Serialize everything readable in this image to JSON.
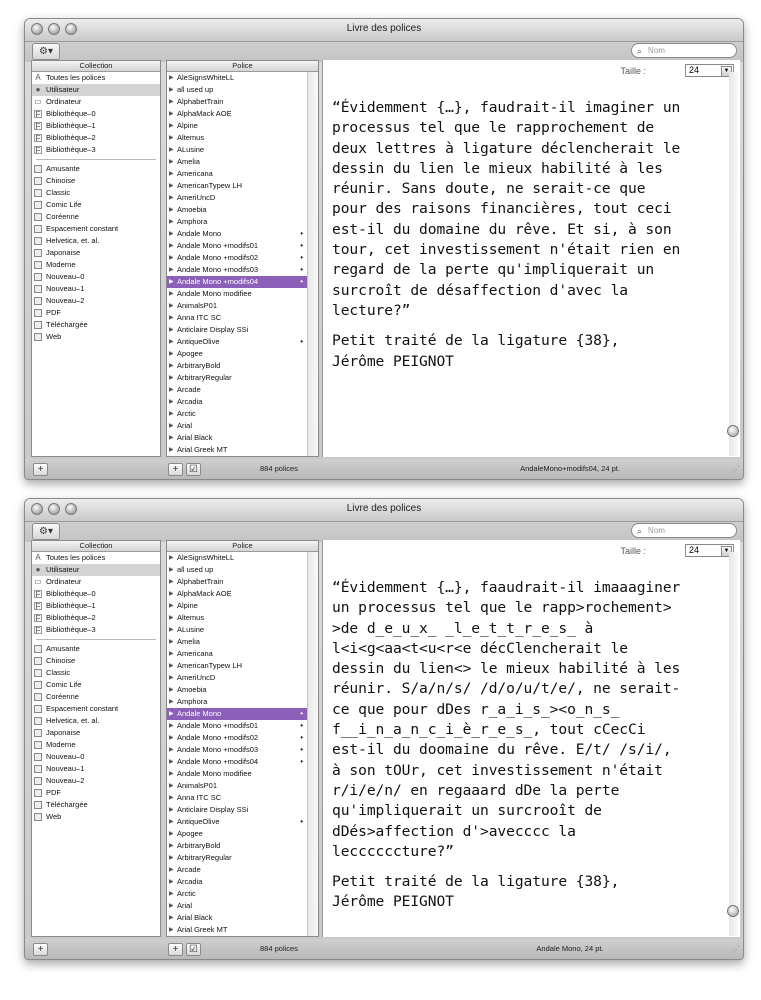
{
  "windows": [
    {
      "title": "Livre des polices",
      "search_placeholder": "Nom",
      "collection_header": "Collection",
      "font_header": "Police",
      "collections": [
        {
          "label": "Toutes les polices",
          "icon": "A"
        },
        {
          "label": "Utilisateur",
          "icon": "person",
          "selected": true
        },
        {
          "label": "Ordinateur",
          "icon": "monitor"
        },
        {
          "label": "Bibliothèque–0",
          "icon": "library"
        },
        {
          "label": "Bibliothèque–1",
          "icon": "library"
        },
        {
          "label": "Bibliothèque–2",
          "icon": "library"
        },
        {
          "label": "Bibliothèque–3",
          "icon": "library"
        }
      ],
      "sets": [
        "Amusante",
        "Chinoise",
        "Classic",
        "Comic Life",
        "Coréenne",
        "Espacement constant",
        "Helvetica, et. al.",
        "Japonaise",
        "Moderne",
        "Nouveau–0",
        "Nouveau–1",
        "Nouveau–2",
        "PDF",
        "Téléchargée",
        "Web"
      ],
      "fonts": [
        {
          "name": "AleSignsWhiteLL"
        },
        {
          "name": "all used up"
        },
        {
          "name": "AlphabetTrain"
        },
        {
          "name": "AlphaMack AOE"
        },
        {
          "name": "Alpine"
        },
        {
          "name": "Altemus"
        },
        {
          "name": "ALusine"
        },
        {
          "name": "Amelia"
        },
        {
          "name": "Americana"
        },
        {
          "name": "AmericanTypew LH"
        },
        {
          "name": "AmeriUncD"
        },
        {
          "name": "Amoebia"
        },
        {
          "name": "Amphora"
        },
        {
          "name": "Andale Mono",
          "dot": true
        },
        {
          "name": "Andale Mono +modifs01",
          "dot": true
        },
        {
          "name": "Andale Mono +modifs02",
          "dot": true
        },
        {
          "name": "Andale Mono +modifs03",
          "dot": true
        },
        {
          "name": "Andale Mono +modifs04",
          "dot": true,
          "selected": true
        },
        {
          "name": "Andale Mono modifiee"
        },
        {
          "name": "AnimalsP01"
        },
        {
          "name": "Anna ITC SC"
        },
        {
          "name": "Anticlaire Display SSi"
        },
        {
          "name": "AntiqueOlive",
          "dot": true
        },
        {
          "name": "Apogee"
        },
        {
          "name": "ArbitraryBold"
        },
        {
          "name": "ArbitraryRegular"
        },
        {
          "name": "Arcade"
        },
        {
          "name": "Arcadia"
        },
        {
          "name": "Arctic"
        },
        {
          "name": "Arial"
        },
        {
          "name": "Arial Black"
        },
        {
          "name": "Arial Greek MT"
        }
      ],
      "size_label": "Taille :",
      "size_value": "24",
      "font_count": "884 polices",
      "status": "AndaleMono+modifs04, 24 pt.",
      "preview_lines": [
        "“Évidemment {…}, faudrait-il imaginer un",
        "processus tel que le rapprochement de",
        "deux lettres à ligature déclencherait le",
        "dessin du lien le mieux habilité à les",
        "réunir. Sans doute, ne serait-ce que",
        "pour des raisons financières, tout ceci",
        "est-il du domaine du rêve. Et si, à son",
        "tour, cet investissement n'était rien en",
        "regard de la perte qu'impliquerait un",
        "surcroît de désaffection d'avec la",
        "lecture?”"
      ],
      "preview_credit": [
        "Petit traité de la ligature {38},",
        "Jérôme PEIGNOT"
      ]
    },
    {
      "title": "Livre des polices",
      "search_placeholder": "Nom",
      "collection_header": "Collection",
      "font_header": "Police",
      "collections": [
        {
          "label": "Toutes les polices",
          "icon": "A"
        },
        {
          "label": "Utilisateur",
          "icon": "person",
          "selected": true
        },
        {
          "label": "Ordinateur",
          "icon": "monitor"
        },
        {
          "label": "Bibliothèque–0",
          "icon": "library"
        },
        {
          "label": "Bibliothèque–1",
          "icon": "library"
        },
        {
          "label": "Bibliothèque–2",
          "icon": "library"
        },
        {
          "label": "Bibliothèque–3",
          "icon": "library"
        }
      ],
      "sets": [
        "Amusante",
        "Chinoise",
        "Classic",
        "Comic Life",
        "Coréenne",
        "Espacement constant",
        "Helvetica, et. al.",
        "Japonaise",
        "Moderne",
        "Nouveau–0",
        "Nouveau–1",
        "Nouveau–2",
        "PDF",
        "Téléchargée",
        "Web"
      ],
      "fonts": [
        {
          "name": "AleSignsWhiteLL"
        },
        {
          "name": "all used up"
        },
        {
          "name": "AlphabetTrain"
        },
        {
          "name": "AlphaMack AOE"
        },
        {
          "name": "Alpine"
        },
        {
          "name": "Altemus"
        },
        {
          "name": "ALusine"
        },
        {
          "name": "Amelia"
        },
        {
          "name": "Americana"
        },
        {
          "name": "AmericanTypew LH"
        },
        {
          "name": "AmeriUncD"
        },
        {
          "name": "Amoebia"
        },
        {
          "name": "Amphora"
        },
        {
          "name": "Andale Mono",
          "dot": true,
          "selected": true
        },
        {
          "name": "Andale Mono +modifs01",
          "dot": true
        },
        {
          "name": "Andale Mono +modifs02",
          "dot": true
        },
        {
          "name": "Andale Mono +modifs03",
          "dot": true
        },
        {
          "name": "Andale Mono +modifs04",
          "dot": true
        },
        {
          "name": "Andale Mono modifiee"
        },
        {
          "name": "AnimalsP01"
        },
        {
          "name": "Anna ITC SC"
        },
        {
          "name": "Anticlaire Display SSi"
        },
        {
          "name": "AntiqueOlive",
          "dot": true
        },
        {
          "name": "Apogee"
        },
        {
          "name": "ArbitraryBold"
        },
        {
          "name": "ArbitraryRegular"
        },
        {
          "name": "Arcade"
        },
        {
          "name": "Arcadia"
        },
        {
          "name": "Arctic"
        },
        {
          "name": "Arial"
        },
        {
          "name": "Arial Black"
        },
        {
          "name": "Arial Greek MT"
        }
      ],
      "size_label": "Taille :",
      "size_value": "24",
      "font_count": "884 polices",
      "status": "Andale Mono, 24 pt.",
      "preview_lines": [
        "“Évidemment {…}, faaudrait-il imaaaginer",
        "un processus tel que le rapp>rochement>",
        ">de d_e_u_x_ _l_e_t_t_r_e_s_ à",
        "l<i<g<aa<t<u<r<e décClencherait le",
        "dessin du lien<> le mieux habilité à les",
        "réunir. S/a/n/s/ /d/o/u/t/e/, ne serait-",
        "ce que pour dDes r_a_i_s_><o_n_s_",
        "f__i_n_a_n_c_i_è_r_e_s_, tout cCecCi",
        "est-il du doomaine du rêve. E/t/ /s/i/,",
        "à son tOUr, cet investissement n'était",
        "r/i/e/n/ en regaaard dDe la perte",
        "qu'impliquerait un surcrooît de",
        "dDés>affection d'>avecccc la",
        "leccccccture?”"
      ],
      "preview_credit": [
        "Petit traité de la ligature {38},",
        "Jérôme PEIGNOT"
      ]
    }
  ]
}
